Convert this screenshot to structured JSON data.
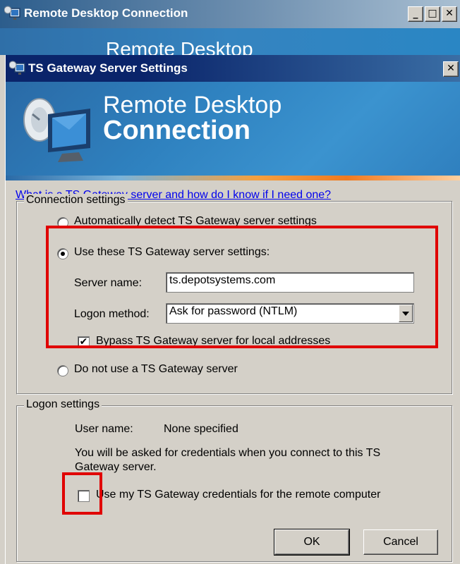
{
  "background_window": {
    "title": "Remote Desktop Connection",
    "banner_text": "Remote Desktop",
    "controls": {
      "minimize": "_",
      "maximize": "□",
      "close": "✕"
    }
  },
  "dialog": {
    "title": "TS Gateway Server Settings",
    "close": "✕",
    "banner": {
      "line1": "Remote Desktop",
      "line2": "Connection"
    },
    "help_link": "What is a TS Gateway server and how do I know if I need one?",
    "connection_settings": {
      "legend": "Connection settings",
      "options": [
        {
          "label": "Automatically detect TS Gateway server settings",
          "selected": false
        },
        {
          "label": "Use these TS Gateway server settings:",
          "selected": true
        },
        {
          "label": "Do not use a TS Gateway server",
          "selected": false
        }
      ],
      "server_name_label": "Server name:",
      "server_name_value": "ts.depotsystems.com",
      "logon_method_label": "Logon method:",
      "logon_method_value": "Ask for password (NTLM)",
      "bypass_label": "Bypass TS Gateway server for local addresses",
      "bypass_checked": true,
      "check_mark": "✔"
    },
    "logon_settings": {
      "legend": "Logon settings",
      "user_name_label": "User name:",
      "user_name_value": "None specified",
      "info_line1": "You will be asked for credentials when you connect to this TS",
      "info_line2": "Gateway server.",
      "use_credentials_label": "Use my TS Gateway credentials for the remote computer",
      "use_credentials_checked": false
    },
    "buttons": {
      "ok": "OK",
      "cancel": "Cancel"
    }
  },
  "colors": {
    "highlight": "#e00000",
    "link": "#0000ee",
    "dialog_face": "#d4d0c8"
  }
}
